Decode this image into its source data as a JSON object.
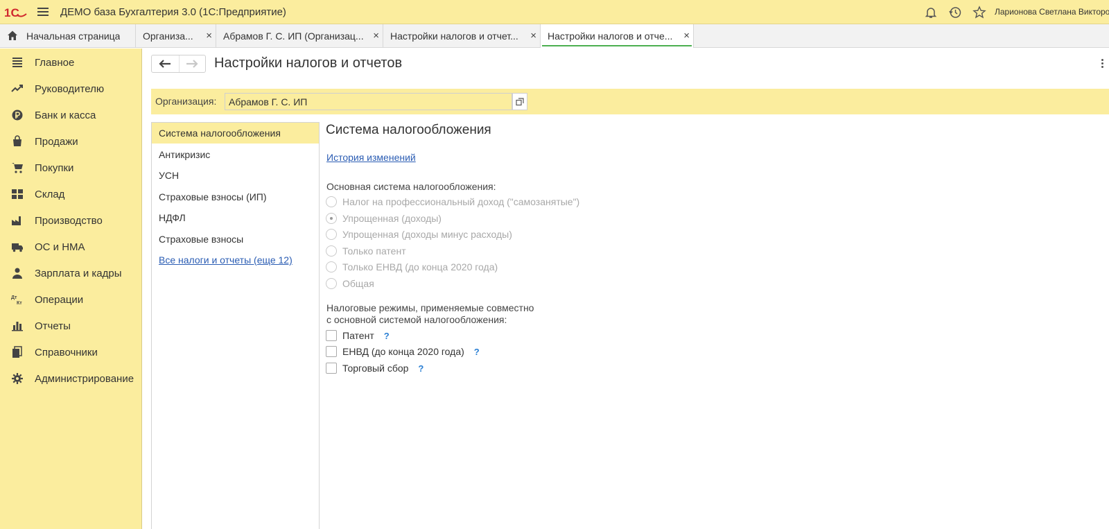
{
  "topbar": {
    "logo_text": "1С",
    "app_title": "ДЕМО база Бухгалтерия 3.0  (1С:Предприятие)",
    "user_name": "Ларионова Светлана Викторовна",
    "icons": [
      "bell-icon",
      "history-icon",
      "star-icon"
    ]
  },
  "tabs": [
    {
      "label": "Начальная страница",
      "icon": "home-icon"
    },
    {
      "label": "Организа...",
      "close": "×"
    },
    {
      "label": "Абрамов Г. С. ИП (Организац...",
      "close": "×"
    },
    {
      "label": "Настройки налогов и отчет...",
      "close": "×"
    },
    {
      "label": "Настройки налогов и отче...",
      "close": "×",
      "active": true
    }
  ],
  "sidebar": {
    "items": [
      {
        "label": "Главное",
        "icon": "menu-lines-icon"
      },
      {
        "label": "Руководителю",
        "icon": "trend-icon"
      },
      {
        "label": "Банк и касса",
        "icon": "ruble-coin-icon"
      },
      {
        "label": "Продажи",
        "icon": "shopping-bag-icon"
      },
      {
        "label": "Покупки",
        "icon": "cart-icon"
      },
      {
        "label": "Склад",
        "icon": "warehouse-icon"
      },
      {
        "label": "Производство",
        "icon": "factory-icon"
      },
      {
        "label": "ОС и НМА",
        "icon": "truck-icon"
      },
      {
        "label": "Зарплата и кадры",
        "icon": "person-icon"
      },
      {
        "label": "Операции",
        "icon": "dt-kt-icon"
      },
      {
        "label": "Отчеты",
        "icon": "bar-chart-icon"
      },
      {
        "label": "Справочники",
        "icon": "books-icon"
      },
      {
        "label": "Администрирование",
        "icon": "gear-icon"
      }
    ]
  },
  "page": {
    "title": "Настройки налогов и отчетов",
    "back_icon": "arrow-left-icon",
    "forward_icon": "arrow-right-icon",
    "more_icon": "more-vertical-icon"
  },
  "organization": {
    "label": "Организация:",
    "value": "Абрамов Г. С. ИП",
    "open_icon": "open-window-icon"
  },
  "sections": {
    "items": [
      {
        "label": "Система налогообложения",
        "selected": true
      },
      {
        "label": "Антикризис"
      },
      {
        "label": "УСН"
      },
      {
        "label": "Страховые взносы (ИП)"
      },
      {
        "label": "НДФЛ"
      },
      {
        "label": "Страховые взносы"
      }
    ],
    "all_link": "Все налоги и отчеты (еще 12)"
  },
  "tax_system": {
    "title": "Система налогообложения",
    "history_link": "История изменений",
    "main_label": "Основная система налогообложения:",
    "options": [
      {
        "label": "Налог на профессиональный доход (\"самозанятые\")",
        "checked": false
      },
      {
        "label": "Упрощенная (доходы)",
        "checked": true
      },
      {
        "label": "Упрощенная (доходы минус расходы)",
        "checked": false
      },
      {
        "label": "Только патент",
        "checked": false
      },
      {
        "label": "Только ЕНВД (до конца 2020 года)",
        "checked": false
      },
      {
        "label": "Общая",
        "checked": false
      }
    ],
    "combined_label_1": "Налоговые режимы, применяемые совместно",
    "combined_label_2": "с основной системой налогообложения:",
    "combined": [
      {
        "label": "Патент",
        "help": "?"
      },
      {
        "label": "ЕНВД (до конца 2020 года)",
        "help": "?"
      },
      {
        "label": "Торговый сбор",
        "help": "?"
      }
    ]
  },
  "colors": {
    "panel_yellow": "#fbed9e",
    "link_blue": "#2a5cb3",
    "active_tab_underline": "#4caf50",
    "help_blue": "#2a7fd4"
  }
}
